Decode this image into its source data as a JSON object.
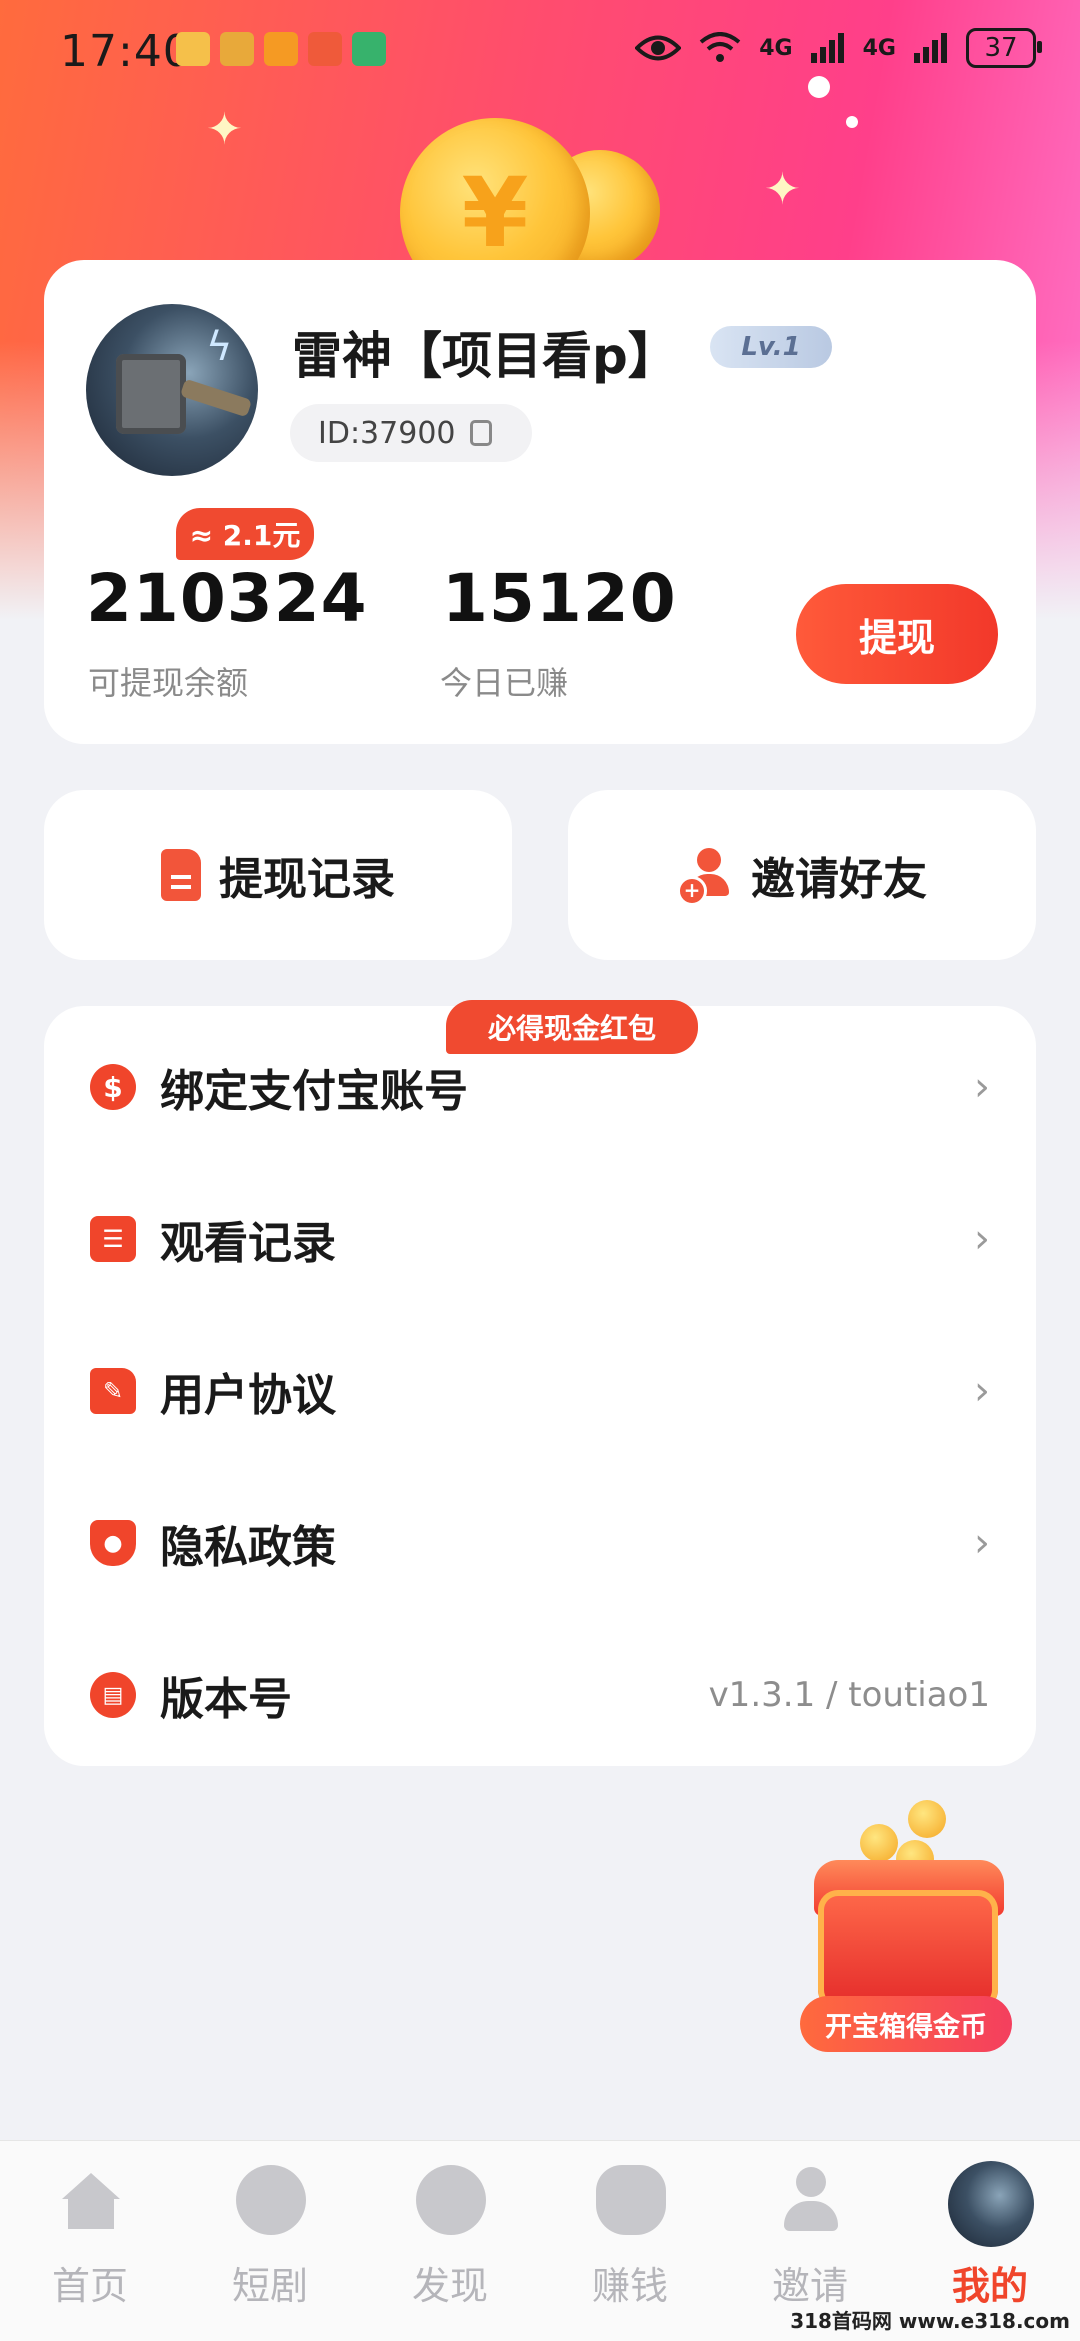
{
  "status_bar": {
    "time": "17:40",
    "network_1": "4G",
    "network_2": "4G",
    "battery": "37"
  },
  "profile": {
    "name": "雷神【项目看p】",
    "level": "Lv.1",
    "id_text": "ID:37900",
    "bonus_tag": "≈ 2.1元",
    "balance_value": "210324",
    "balance_label": "可提现余额",
    "today_value": "15120",
    "today_label": "今日已赚",
    "withdraw_label": "提现"
  },
  "quick_actions": {
    "withdraw_records": "提现记录",
    "invite_friends": "邀请好友"
  },
  "menu": {
    "red_packet_tag": "必得现金红包",
    "items": [
      {
        "label": "绑定支付宝账号",
        "icon": "dollar-icon",
        "color": "#f0452b"
      },
      {
        "label": "观看记录",
        "icon": "list-icon",
        "color": "#f0452b"
      },
      {
        "label": "用户协议",
        "icon": "edit-document-icon",
        "color": "#f0452b"
      },
      {
        "label": "隐私政策",
        "icon": "shield-lock-icon",
        "color": "#f0452b"
      },
      {
        "label": "版本号",
        "icon": "book-icon",
        "color": "#f0452b"
      }
    ],
    "version_value": "v1.3.1 / toutiao1"
  },
  "treasure": {
    "label": "开宝箱得金币"
  },
  "bottom_nav": {
    "items": [
      {
        "label": "首页",
        "icon": "home-icon"
      },
      {
        "label": "短剧",
        "icon": "film-reel-icon"
      },
      {
        "label": "发现",
        "icon": "compass-icon"
      },
      {
        "label": "赚钱",
        "icon": "money-bag-icon"
      },
      {
        "label": "邀请",
        "icon": "add-user-icon"
      },
      {
        "label": "我的",
        "icon": "avatar"
      }
    ],
    "active_color": "#f0452b"
  },
  "watermark": "318首码网 www.e318.com"
}
